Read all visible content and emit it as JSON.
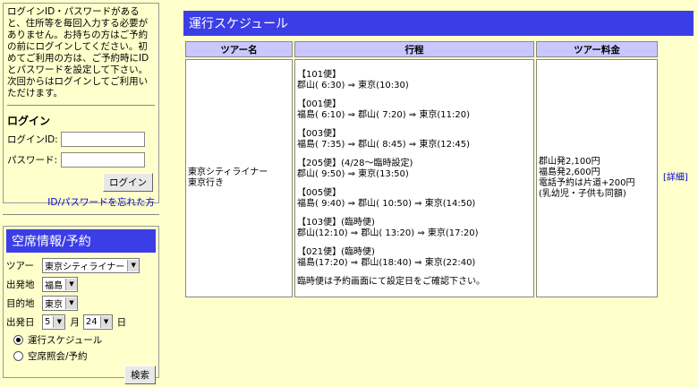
{
  "sidebar": {
    "login_notice": "ログインID・パスワードがあると、住所等を毎回入力する必要がありません。お持ちの方はご予約の前にログインしてください。初めてご利用の方は、ご予約時にIDとパスワードを設定して下さい。次回からはログインしてご利用いただけます。",
    "login_heading": "ログイン",
    "login_id_label": "ログインID:",
    "password_label": "パスワード:",
    "login_id_value": "",
    "password_value": "",
    "login_button": "ログイン",
    "forgot_link": "ID/パスワードを忘れた方",
    "seat": {
      "heading": "空席情報/予約",
      "tour_label": "ツアー",
      "tour_value": "東京シティライナー",
      "depart_label": "出発地",
      "depart_value": "福島",
      "dest_label": "目的地",
      "dest_value": "東京",
      "date_label": "出発日",
      "month_value": "5",
      "month_unit": "月",
      "day_value": "24",
      "day_unit": "日",
      "radio_schedule": "運行スケジュール",
      "radio_inquiry": "空席照会/予約",
      "search_button": "検索"
    }
  },
  "main": {
    "title": "運行スケジュール",
    "headers": [
      "ツアー名",
      "行程",
      "ツアー料金"
    ],
    "tour_name_line1": "東京シティライナー",
    "tour_name_line2": "東京行き",
    "schedule": [
      "【101便】\n郡山( 6:30) ⇒ 東京(10:30)",
      "【001便】\n福島( 6:10) ⇒ 郡山( 7:20) ⇒ 東京(11:20)",
      "【003便】\n福島( 7:35) ⇒ 郡山( 8:45) ⇒ 東京(12:45)",
      "【205便】(4/28～臨時設定)\n郡山( 9:50) ⇒ 東京(13:50)",
      "【005便】\n福島( 9:40) ⇒ 郡山( 10:50) ⇒ 東京(14:50)",
      "【103便】(臨時便)\n郡山(12:10) ⇒ 郡山( 13:20) ⇒ 東京(17:20)",
      "【021便】(臨時便)\n福島(17:20) ⇒ 郡山(18:40) ⇒ 東京(22:40)",
      "臨時便は予約画面にて設定日をご確認下さい。"
    ],
    "fare_lines": [
      "郡山発2,100円",
      "福島発2,600円",
      "電話予約は片道+200円",
      "(乳幼児・子供も同額)"
    ],
    "detail_link": "[詳細]"
  }
}
